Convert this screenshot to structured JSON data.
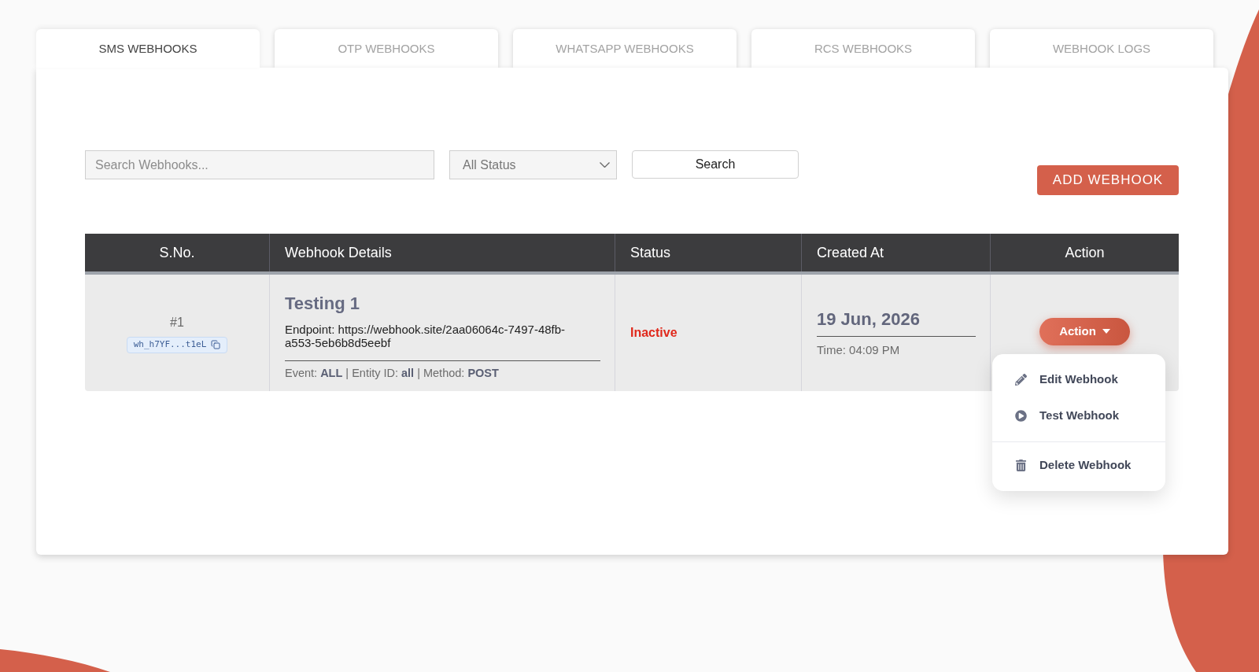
{
  "tabs": [
    {
      "label": "SMS WEBHOOKS",
      "selected": true
    },
    {
      "label": "OTP WEBHOOKS",
      "selected": false
    },
    {
      "label": "WHATSAPP WEBHOOKS",
      "selected": false
    },
    {
      "label": "RCS WEBHOOKS",
      "selected": false
    },
    {
      "label": "WEBHOOK LOGS",
      "selected": false
    }
  ],
  "filters": {
    "search": {
      "placeholder": "Search Webhooks..."
    },
    "status_select": {
      "value": "All Status"
    },
    "search_button": "Search"
  },
  "add_button": "ADD WEBHOOK",
  "table": {
    "columns": [
      "S.No.",
      "Webhook Details",
      "Status",
      "Created At",
      "Action"
    ],
    "rows": [
      {
        "serial": "#1",
        "webhook_id": "wh_h7YF...t1eL",
        "name": "Testing 1",
        "endpoint": "Endpoint: https://webhook.site/2aa06064c-7497-48fb-a553-5eb6b8d5eebf",
        "meta": "Event: **ALL** | Entity ID: **all** | Method: **POST**",
        "status": "Inactive",
        "active": false,
        "created_date": "19 Jun, 2026",
        "created_time": "Time: 04:09 PM",
        "action": {
          "label": "Action",
          "expanded": true,
          "menu": {
            "groups": [
              {
                "items": [
                  {
                    "kind": "edit",
                    "label": "Edit Webhook"
                  },
                  {
                    "kind": "test",
                    "label": "Test Webhook"
                  }
                ]
              },
              {
                "items": [
                  {
                    "kind": "delete",
                    "label": "Delete Webhook"
                  }
                ]
              }
            ]
          }
        }
      }
    ]
  }
}
